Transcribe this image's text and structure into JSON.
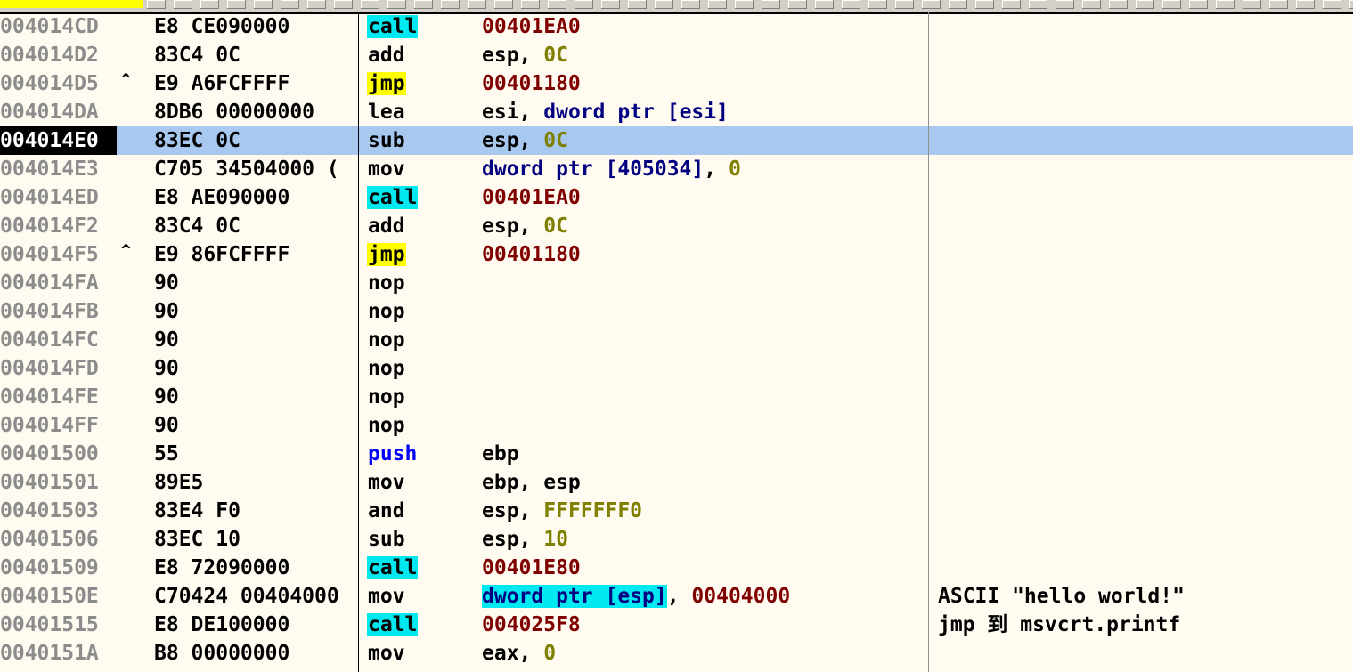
{
  "rows": [
    {
      "addr": "004014CD",
      "mark": "",
      "hex": "E8 CE090000",
      "mnem": "call",
      "mtype": "call",
      "ops": [
        {
          "t": "00401EA0",
          "c": "addr"
        }
      ],
      "comment": ""
    },
    {
      "addr": "004014D2",
      "mark": "",
      "hex": "83C4 0C",
      "mnem": "add",
      "mtype": "plain",
      "ops": [
        {
          "t": "esp, ",
          "c": "reg"
        },
        {
          "t": "0C",
          "c": "num"
        }
      ],
      "comment": ""
    },
    {
      "addr": "004014D5",
      "mark": "^",
      "hex": "E9 A6FCFFFF",
      "mnem": "jmp",
      "mtype": "jmp",
      "ops": [
        {
          "t": "00401180",
          "c": "addr"
        }
      ],
      "comment": ""
    },
    {
      "addr": "004014DA",
      "mark": "",
      "hex": "8DB6 00000000",
      "mnem": "lea",
      "mtype": "plain",
      "ops": [
        {
          "t": "esi, ",
          "c": "reg"
        },
        {
          "t": "dword ptr [esi]",
          "c": "mem"
        }
      ],
      "comment": ""
    },
    {
      "addr": "004014E0",
      "mark": "",
      "hex": "83EC 0C",
      "mnem": "sub",
      "mtype": "plain",
      "ops": [
        {
          "t": "esp, ",
          "c": "reg"
        },
        {
          "t": "0C",
          "c": "num"
        }
      ],
      "comment": "",
      "selected": true
    },
    {
      "addr": "004014E3",
      "mark": "",
      "hex": "C705 34504000 (",
      "mnem": "mov",
      "mtype": "plain",
      "ops": [
        {
          "t": "dword ptr [405034]",
          "c": "mem"
        },
        {
          "t": ", ",
          "c": "reg"
        },
        {
          "t": "0",
          "c": "num"
        }
      ],
      "comment": ""
    },
    {
      "addr": "004014ED",
      "mark": "",
      "hex": "E8 AE090000",
      "mnem": "call",
      "mtype": "call",
      "ops": [
        {
          "t": "00401EA0",
          "c": "addr"
        }
      ],
      "comment": ""
    },
    {
      "addr": "004014F2",
      "mark": "",
      "hex": "83C4 0C",
      "mnem": "add",
      "mtype": "plain",
      "ops": [
        {
          "t": "esp, ",
          "c": "reg"
        },
        {
          "t": "0C",
          "c": "num"
        }
      ],
      "comment": ""
    },
    {
      "addr": "004014F5",
      "mark": "^",
      "hex": "E9 86FCFFFF",
      "mnem": "jmp",
      "mtype": "jmp",
      "ops": [
        {
          "t": "00401180",
          "c": "addr"
        }
      ],
      "comment": ""
    },
    {
      "addr": "004014FA",
      "mark": "",
      "hex": "90",
      "mnem": "nop",
      "mtype": "plain",
      "ops": [],
      "comment": ""
    },
    {
      "addr": "004014FB",
      "mark": "",
      "hex": "90",
      "mnem": "nop",
      "mtype": "plain",
      "ops": [],
      "comment": ""
    },
    {
      "addr": "004014FC",
      "mark": "",
      "hex": "90",
      "mnem": "nop",
      "mtype": "plain",
      "ops": [],
      "comment": ""
    },
    {
      "addr": "004014FD",
      "mark": "",
      "hex": "90",
      "mnem": "nop",
      "mtype": "plain",
      "ops": [],
      "comment": ""
    },
    {
      "addr": "004014FE",
      "mark": "",
      "hex": "90",
      "mnem": "nop",
      "mtype": "plain",
      "ops": [],
      "comment": ""
    },
    {
      "addr": "004014FF",
      "mark": "",
      "hex": "90",
      "mnem": "nop",
      "mtype": "plain",
      "ops": [],
      "comment": ""
    },
    {
      "addr": "00401500",
      "mark": "",
      "hex": "55",
      "mnem": "push",
      "mtype": "push",
      "ops": [
        {
          "t": "ebp",
          "c": "reg"
        }
      ],
      "comment": ""
    },
    {
      "addr": "00401501",
      "mark": "",
      "hex": "89E5",
      "mnem": "mov",
      "mtype": "plain",
      "ops": [
        {
          "t": "ebp, esp",
          "c": "reg"
        }
      ],
      "comment": ""
    },
    {
      "addr": "00401503",
      "mark": "",
      "hex": "83E4 F0",
      "mnem": "and",
      "mtype": "plain",
      "ops": [
        {
          "t": "esp, ",
          "c": "reg"
        },
        {
          "t": "FFFFFFF0",
          "c": "num"
        }
      ],
      "comment": ""
    },
    {
      "addr": "00401506",
      "mark": "",
      "hex": "83EC 10",
      "mnem": "sub",
      "mtype": "plain",
      "ops": [
        {
          "t": "esp, ",
          "c": "reg"
        },
        {
          "t": "10",
          "c": "num"
        }
      ],
      "comment": ""
    },
    {
      "addr": "00401509",
      "mark": "",
      "hex": "E8 72090000",
      "mnem": "call",
      "mtype": "call",
      "ops": [
        {
          "t": "00401E80",
          "c": "addr"
        }
      ],
      "comment": ""
    },
    {
      "addr": "0040150E",
      "mark": "",
      "hex": "C70424 00404000",
      "mnem": "mov",
      "mtype": "plain",
      "ops": [
        {
          "t": "dword ptr [esp]",
          "c": "memhl"
        },
        {
          "t": ", ",
          "c": "reg"
        },
        {
          "t": "00404000",
          "c": "addr"
        }
      ],
      "comment": "ASCII \"hello world!\""
    },
    {
      "addr": "00401515",
      "mark": "",
      "hex": "E8 DE100000",
      "mnem": "call",
      "mtype": "call",
      "ops": [
        {
          "t": "004025F8",
          "c": "addr"
        }
      ],
      "comment": "jmp 到 msvcrt.printf"
    },
    {
      "addr": "0040151A",
      "mark": "",
      "hex": "B8 00000000",
      "mnem": "mov",
      "mtype": "plain",
      "ops": [
        {
          "t": "eax, ",
          "c": "reg"
        },
        {
          "t": "0",
          "c": "num"
        }
      ],
      "comment": ""
    }
  ]
}
